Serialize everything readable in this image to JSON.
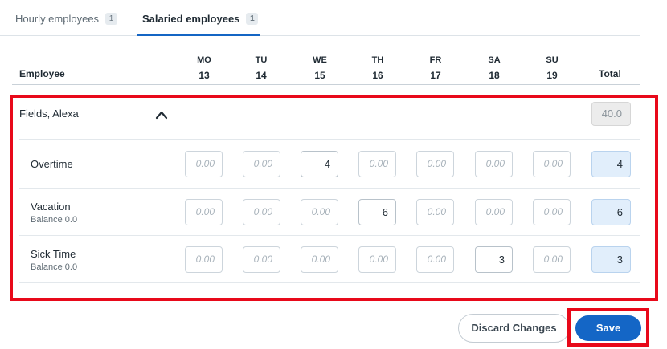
{
  "tabs": [
    {
      "label": "Hourly employees",
      "count": "1"
    },
    {
      "label": "Salaried employees",
      "count": "1"
    }
  ],
  "table_header": {
    "employee": "Employee",
    "total": "Total",
    "days": [
      {
        "name": "MO",
        "date": "13"
      },
      {
        "name": "TU",
        "date": "14"
      },
      {
        "name": "WE",
        "date": "15"
      },
      {
        "name": "TH",
        "date": "16"
      },
      {
        "name": "FR",
        "date": "17"
      },
      {
        "name": "SA",
        "date": "18"
      },
      {
        "name": "SU",
        "date": "19"
      }
    ]
  },
  "employee": {
    "name": "Fields, Alexa",
    "total": "40.0",
    "rows": [
      {
        "label": "Overtime",
        "sub": "",
        "cells": [
          "0.00",
          "0.00",
          "4",
          "0.00",
          "0.00",
          "0.00",
          "0.00"
        ],
        "total": "4"
      },
      {
        "label": "Vacation",
        "sub": "Balance 0.0",
        "cells": [
          "0.00",
          "0.00",
          "0.00",
          "6",
          "0.00",
          "0.00",
          "0.00"
        ],
        "total": "6"
      },
      {
        "label": "Sick Time",
        "sub": "Balance 0.0",
        "cells": [
          "0.00",
          "0.00",
          "0.00",
          "0.00",
          "0.00",
          "3",
          "0.00"
        ],
        "total": "3"
      }
    ]
  },
  "actions": {
    "discard_label": "Discard Changes",
    "save_label": "Save"
  },
  "colors": {
    "accent": "#1466c6",
    "highlight": "#e8091a",
    "total_cell_bg": "#e1eefb"
  },
  "icons": {
    "collapse": "chevron-up-icon"
  }
}
